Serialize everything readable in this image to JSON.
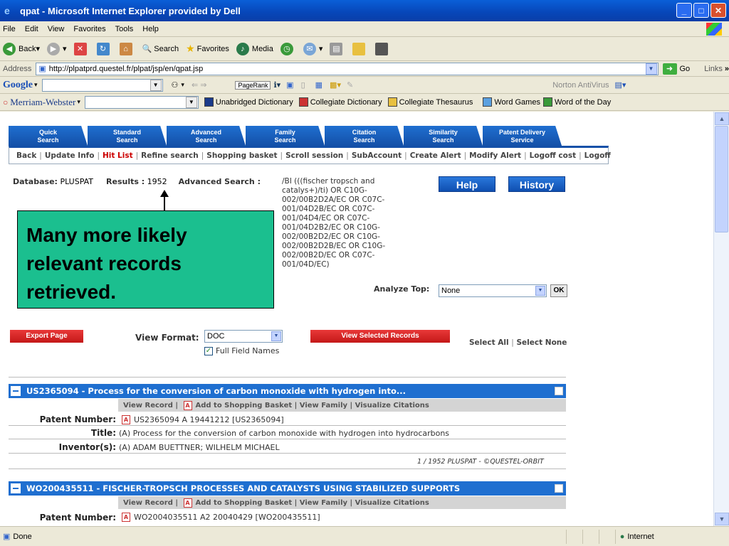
{
  "window": {
    "title": "qpat - Microsoft Internet Explorer provided by Dell"
  },
  "menu": [
    "File",
    "Edit",
    "View",
    "Favorites",
    "Tools",
    "Help"
  ],
  "toolbar": {
    "back": "Back",
    "search": "Search",
    "favorites": "Favorites",
    "media": "Media"
  },
  "address": {
    "label": "Address",
    "url": "http://plpatprd.questel.fr/plpat/jsp/en/qpat.jsp",
    "go": "Go",
    "links": "Links"
  },
  "google": {
    "label": "Google",
    "pagerank": "PageRank",
    "norton": "Norton AntiVirus"
  },
  "mw": {
    "label": "Merriam-Webster",
    "items": [
      "Unabridged Dictionary",
      "Collegiate Dictionary",
      "Collegiate Thesaurus",
      "Word Games",
      "Word of the Day"
    ]
  },
  "tabs": [
    {
      "l1": "Quick",
      "l2": "Search"
    },
    {
      "l1": "Standard",
      "l2": "Search"
    },
    {
      "l1": "Advanced",
      "l2": "Search"
    },
    {
      "l1": "Family",
      "l2": "Search"
    },
    {
      "l1": "Citation",
      "l2": "Search"
    },
    {
      "l1": "Similarity",
      "l2": "Search"
    },
    {
      "l1": "Patent Delivery",
      "l2": "Service"
    }
  ],
  "subnav": [
    "Back",
    "Update Info",
    "Hit List",
    "Refine search",
    "Shopping basket",
    "Scroll session",
    "SubAccount",
    "Create Alert",
    "Modify Alert",
    "Logoff cost",
    "Logoff"
  ],
  "db": {
    "label": "Database:",
    "value": "PLUSPAT",
    "results_label": "Results :",
    "results": "1952",
    "adv_label": "Advanced Search :"
  },
  "query": "/BI (((fischer tropsch and catalys+)/ti) OR C10G-002/00B2D2A/EC OR C07C-001/04D2B/EC OR C07C-001/04D4/EC OR C07C-001/04D2B2/EC OR C10G-002/00B2D2/EC OR C10G-002/00B2D2B/EC OR C10G-002/00B2D/EC OR C07C-001/04D/EC)",
  "buttons": {
    "help": "Help",
    "history": "History",
    "ok": "OK",
    "export": "Export Page",
    "view_selected": "View Selected Records"
  },
  "callout": {
    "text": "Many more likely relevant records retrieved."
  },
  "analyze": {
    "label": "Analyze Top:",
    "value": "None"
  },
  "view_format": {
    "label": "View Format:",
    "value": "DOC",
    "full_field": "Full Field Names"
  },
  "select": {
    "all": "Select All",
    "sep": "|",
    "none": "Select None"
  },
  "record_links": [
    "View Record",
    "Add to Shopping Basket",
    "View Family",
    "Visualize Citations"
  ],
  "records": [
    {
      "head": "US2365094 - Process for the conversion of carbon monoxide with hydrogen into...",
      "patent_label": "Patent Number:",
      "patent": "US2365094 A 19441212 [US2365094]",
      "title_label": "Title:",
      "title": "(A) Process for the conversion of carbon monoxide with hydrogen into hydrocarbons",
      "inventor_label": "Inventor(s):",
      "inventor": "(A) ADAM BUETTNER; WILHELM MICHAEL",
      "foot": "1 / 1952 PLUSPAT - ©QUESTEL-ORBIT"
    },
    {
      "head": "WO200435511 - FISCHER-TROPSCH PROCESSES AND CATALYSTS USING STABILIZED SUPPORTS",
      "patent_label": "Patent Number:",
      "patent": "WO2004035511 A2 20040429 [WO200435511]"
    }
  ],
  "status": {
    "text": "Done",
    "zone": "Internet"
  }
}
